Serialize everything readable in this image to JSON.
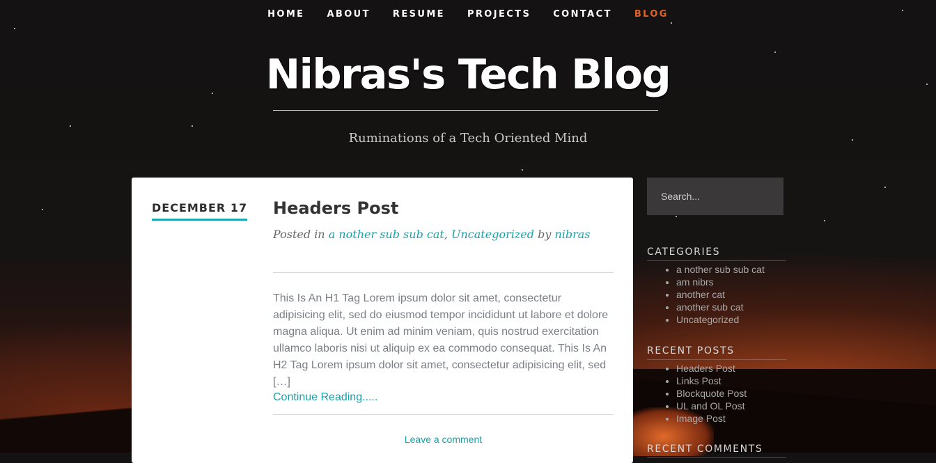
{
  "nav": {
    "items": [
      {
        "label": "HOME",
        "active": false
      },
      {
        "label": "ABOUT",
        "active": false
      },
      {
        "label": "RESUME",
        "active": false
      },
      {
        "label": "PROJECTS",
        "active": false
      },
      {
        "label": "CONTACT",
        "active": false
      },
      {
        "label": "BLOG",
        "active": true
      }
    ]
  },
  "site": {
    "title": "Nibras's Tech Blog",
    "tagline": "Ruminations of a Tech Oriented Mind"
  },
  "post": {
    "date": "DECEMBER 17",
    "title": "Headers Post",
    "meta_prefix": "Posted in",
    "categories": [
      "a nother sub sub cat",
      "Uncategorized"
    ],
    "meta_separator": ",",
    "meta_by": "by",
    "author": "nibras",
    "excerpt": "This Is An H1 Tag Lorem ipsum dolor sit amet, consectetur adipisicing elit, sed do eiusmod tempor incididunt ut labore et dolore magna aliqua. Ut enim ad minim veniam, quis nostrud exercitation ullamco laboris nisi ut aliquip ex ea commodo consequat. This Is An H2 Tag Lorem ipsum dolor sit amet, consectetur adipisicing elit, sed […]",
    "continue_label": "Continue Reading.....",
    "comment_label": "Leave a comment"
  },
  "sidebar": {
    "search_placeholder": "Search...",
    "categories_title": "CATEGORIES",
    "categories": [
      "a nother sub sub cat",
      "am nibrs",
      "another cat",
      "another sub cat",
      "Uncategorized"
    ],
    "recent_posts_title": "RECENT POSTS",
    "recent_posts": [
      "Headers Post",
      "Links Post",
      "Blockquote Post",
      "UL and OL Post",
      "Image Post"
    ],
    "recent_comments_title": "RECENT COMMENTS"
  },
  "colors": {
    "accent": "#1ba0a8",
    "nav_active": "#e2632a",
    "card": "#ffffff"
  }
}
